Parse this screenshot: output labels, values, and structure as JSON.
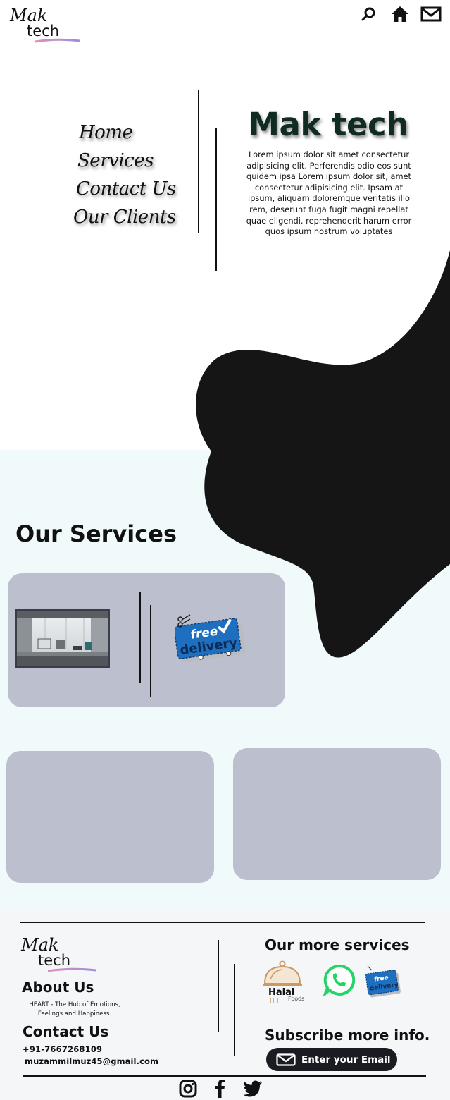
{
  "header": {
    "logo_line1": "Mak",
    "logo_line2": "tech",
    "icons": [
      "search-icon",
      "home-icon",
      "mail-icon"
    ]
  },
  "nav": {
    "items": [
      {
        "label": "Home"
      },
      {
        "label": "Services"
      },
      {
        "label": "Contact Us"
      },
      {
        "label": "Our Clients"
      }
    ]
  },
  "hero": {
    "title": "Mak tech",
    "text": "Lorem ipsum dolor sit amet consectetur adipisicing elit. Perferendis odio eos sunt quidem ipsa Lorem ipsum dolor sit, amet consectetur adipisicing elit. Ipsam at ipsum, aliquam doloremque veritatis illo rem, deserunt fuga fugit magni repellat quae eligendi. reprehenderit harum error quos ipsum nostrum voluptates"
  },
  "services": {
    "title": "Our Services",
    "delivery_badge_line1": "free",
    "delivery_badge_line2": "delivery"
  },
  "footer": {
    "logo_line1": "Mak",
    "logo_line2": "tech",
    "about_title": "About Us",
    "about_text": "HEART - The Hub of Emotions, Feelings and Happiness.",
    "contact_title": "Contact Us",
    "phone": "+91-7667268109",
    "email": "muzammilmuz45@gmail.com",
    "more_services_title": "Our more services",
    "halal_label": "Halal",
    "halal_sub": "Foods",
    "subscribe_title": "Subscribe more info.",
    "subscribe_button": "Enter your Email",
    "social_icons": [
      "instagram-icon",
      "facebook-icon",
      "twitter-icon"
    ]
  },
  "colors": {
    "card": "#bcbfcd",
    "blob": "#151515",
    "services_bg": "#f1fafb",
    "footer_bg": "#f5f6f8",
    "hero_title": "#0f2b24",
    "button_bg": "#1b1c22",
    "whatsapp": "#25d366",
    "delivery_blue": "#1f6fc0"
  }
}
